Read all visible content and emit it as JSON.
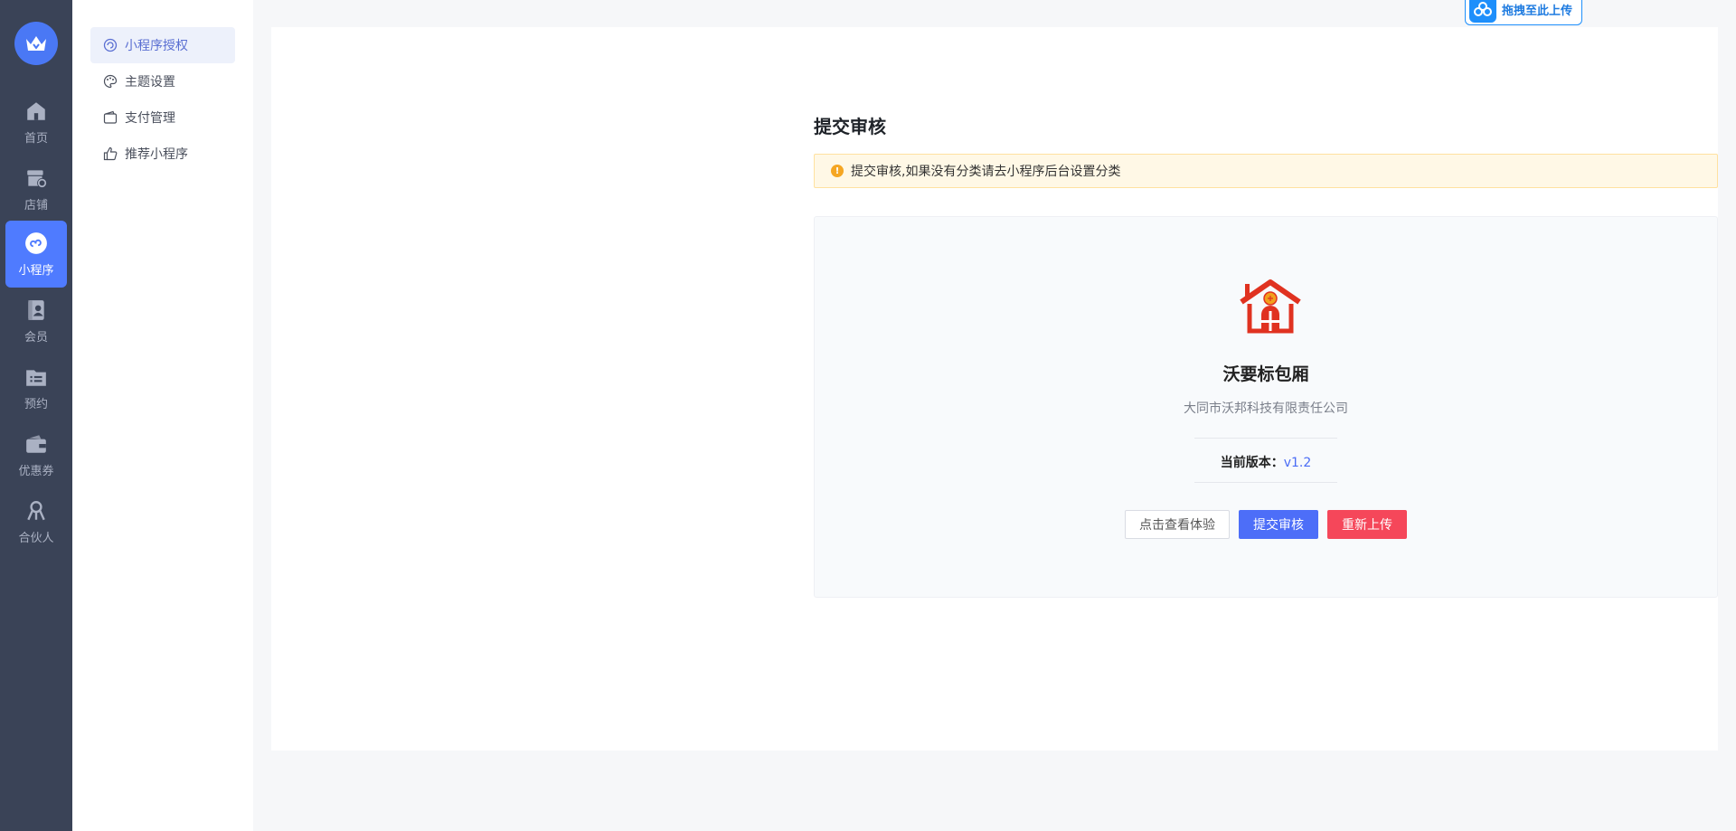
{
  "rail": {
    "items": [
      {
        "label": "首页",
        "icon": "home-icon"
      },
      {
        "label": "店铺",
        "icon": "store-icon"
      },
      {
        "label": "小程序",
        "icon": "miniprogram-icon",
        "active": true
      },
      {
        "label": "会员",
        "icon": "member-icon"
      },
      {
        "label": "预约",
        "icon": "appointment-icon"
      },
      {
        "label": "优惠券",
        "icon": "coupon-icon"
      },
      {
        "label": "合伙人",
        "icon": "partner-icon"
      }
    ]
  },
  "subnav": {
    "items": [
      {
        "label": "小程序授权",
        "icon": "authorize-icon",
        "active": true
      },
      {
        "label": "主题设置",
        "icon": "palette-icon"
      },
      {
        "label": "支付管理",
        "icon": "wallet-icon"
      },
      {
        "label": "推荐小程序",
        "icon": "thumbs-up-icon"
      }
    ]
  },
  "main": {
    "title": "提交审核",
    "alert": "提交审核,如果没有分类请去小程序后台设置分类",
    "app": {
      "name": "沃要标包厢",
      "company": "大同市沃邦科技有限责任公司",
      "version_label": "当前版本：",
      "version_value": "v1.2"
    },
    "buttons": {
      "preview": "点击查看体验",
      "submit": "提交审核",
      "reupload": "重新上传"
    }
  },
  "upload_widget": {
    "label": "拖拽至此上传"
  },
  "colors": {
    "rail_bg": "#3a4357",
    "accent": "#4f7bff",
    "danger": "#f5475a",
    "warning_bg": "#fff8e6"
  }
}
